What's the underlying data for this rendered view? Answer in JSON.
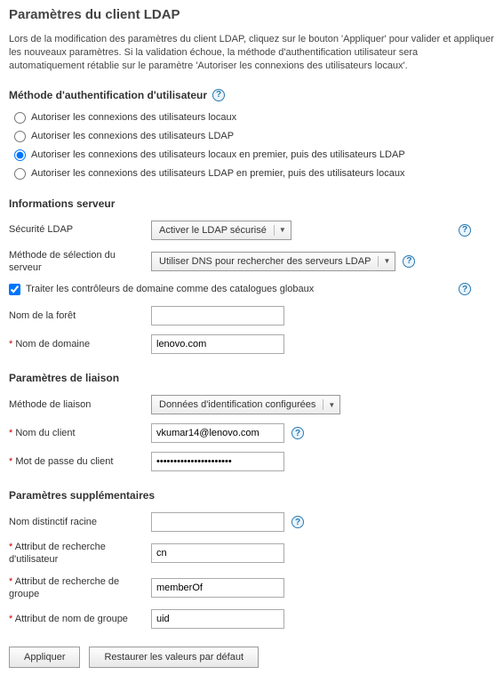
{
  "page": {
    "title": "Paramètres du client LDAP",
    "intro": "Lors de la modification des paramètres du client LDAP, cliquez sur le bouton 'Appliquer' pour valider et appliquer les nouveaux paramètres. Si la validation échoue, la méthode d'authentification utilisateur sera automatiquement rétablie sur le paramètre 'Autoriser les connexions des utilisateurs locaux'."
  },
  "auth": {
    "heading": "Méthode d'authentification d'utilisateur",
    "options": [
      "Autoriser les connexions des utilisateurs locaux",
      "Autoriser les connexions des utilisateurs LDAP",
      "Autoriser les connexions des utilisateurs locaux en premier, puis des utilisateurs LDAP",
      "Autoriser les connexions des utilisateurs LDAP en premier, puis des utilisateurs locaux"
    ],
    "selected_index": 2
  },
  "server": {
    "heading": "Informations serveur",
    "security_label": "Sécurité LDAP",
    "security_value": "Activer le LDAP sécurisé",
    "selection_label": "Méthode de sélection du serveur",
    "selection_value": "Utiliser DNS pour rechercher des serveurs LDAP",
    "treat_dc_label": "Traiter les contrôleurs de domaine comme des catalogues globaux",
    "treat_dc_checked": true,
    "forest_label": "Nom de la forêt",
    "forest_value": "",
    "domain_label": "Nom de domaine",
    "domain_value": "lenovo.com"
  },
  "binding": {
    "heading": "Paramètres de liaison",
    "method_label": "Méthode de liaison",
    "method_value": "Données d'identification configurées",
    "client_name_label": "Nom du client",
    "client_name_value": "vkumar14@lenovo.com",
    "client_password_label": "Mot de passe du client",
    "client_password_value": "••••••••••••••••••••••"
  },
  "extra": {
    "heading": "Paramètres supplémentaires",
    "root_dn_label": "Nom distinctif racine",
    "root_dn_value": "",
    "user_search_label": "Attribut de recherche d'utilisateur",
    "user_search_value": "cn",
    "group_search_label": "Attribut de recherche de groupe",
    "group_search_value": "memberOf",
    "group_name_label": "Attribut de nom de groupe",
    "group_name_value": "uid"
  },
  "buttons": {
    "apply": "Appliquer",
    "restore": "Restaurer les valeurs par défaut"
  }
}
